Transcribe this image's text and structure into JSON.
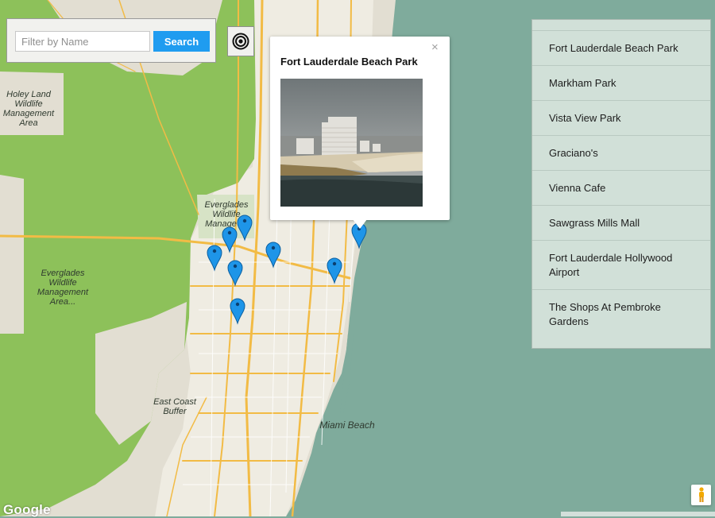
{
  "filter": {
    "placeholder": "Filter by Name",
    "search_label": "Search"
  },
  "locate_button": {
    "icon": "target-icon"
  },
  "info_window": {
    "title": "Fort Lauderdale Beach Park",
    "close_label": "×",
    "photo_icon": "beach-photo"
  },
  "map": {
    "labels": {
      "holey_land_1": "Holey Land",
      "holey_land_2": "Wildlife",
      "holey_land_3": "Management",
      "holey_land_4": "Area",
      "everglades_ne_1": "Everglades",
      "everglades_ne_2": "Wildlife",
      "everglades_ne_3": "Manage",
      "everglades_w_1": "Everglades",
      "everglades_w_2": "Wildlife",
      "everglades_w_3": "Management",
      "everglades_w_4": "Area...",
      "east_coast_1": "East Coast",
      "east_coast_2": "Buffer",
      "miami_beach": "Miami Beach"
    },
    "colors": {
      "water": "#7fab9c",
      "land": "#e2ded2",
      "park": "#8dc15a",
      "urban": "#efece2",
      "road": "#f2bb45",
      "marker": "#1e95e8"
    }
  },
  "places": [
    "Fort Lauderdale Beach Park",
    "Markham Park",
    "Vista View Park",
    "Graciano's",
    "Vienna Cafe",
    "Sawgrass Mills Mall",
    "Fort Lauderdale Hollywood Airport",
    "The Shops At Pembroke Gardens"
  ],
  "google_logo": "Google",
  "pegman_icon": "pegman-icon"
}
